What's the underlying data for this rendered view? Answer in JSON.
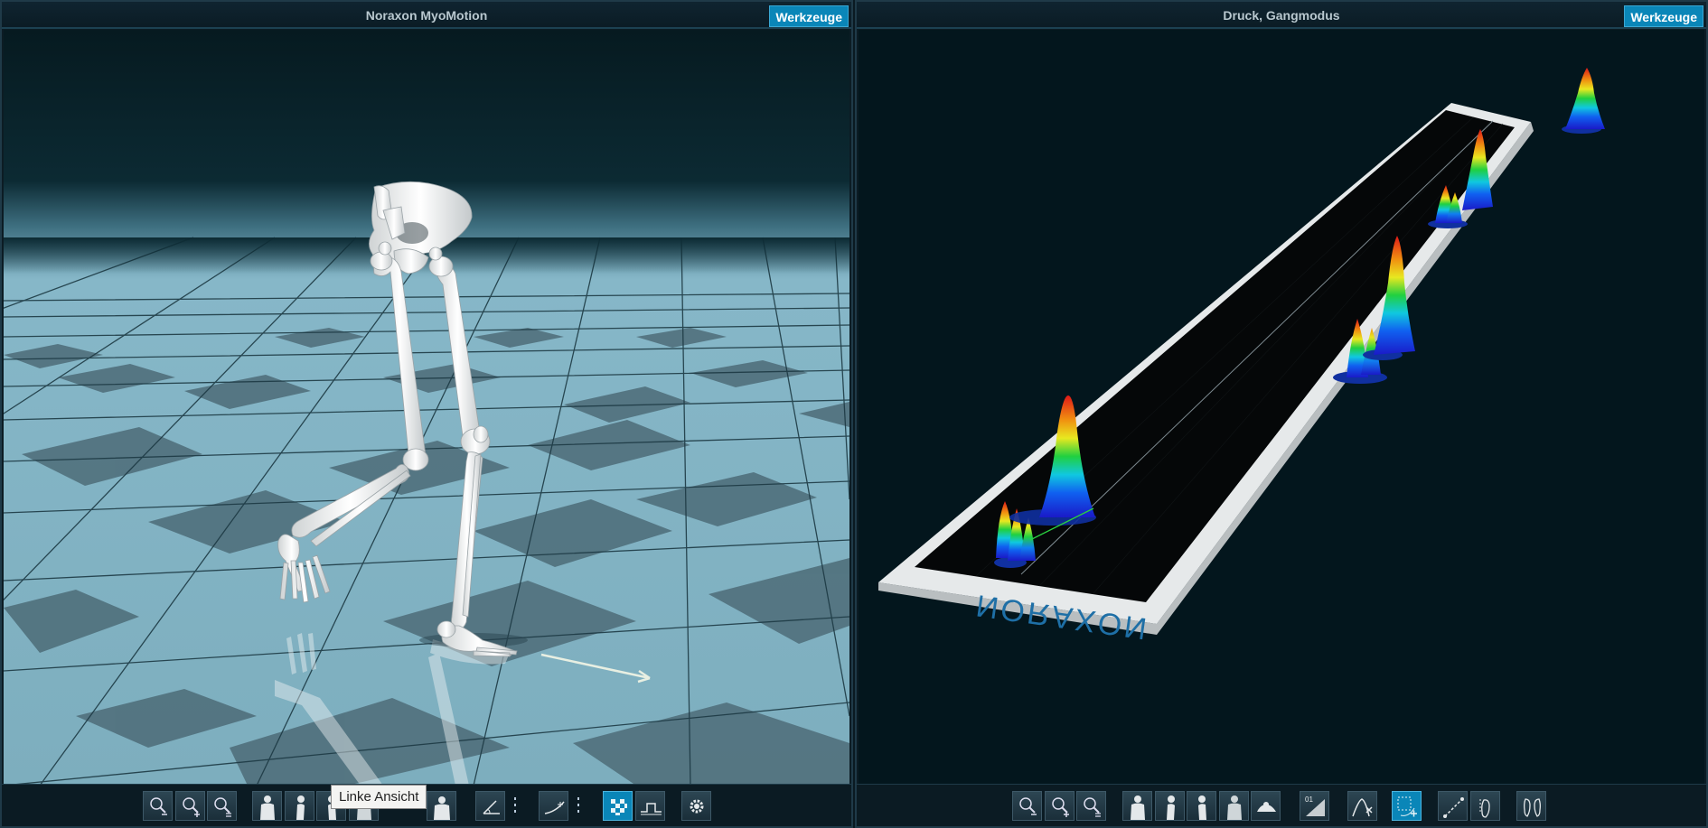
{
  "left_panel": {
    "title": "Noraxon MyoMotion",
    "tools_label": "Werkzeuge",
    "tooltip": "Linke Ansicht"
  },
  "right_panel": {
    "title": "Druck, Gangmodus",
    "tools_label": "Werkzeuge",
    "mat_brand": "NORAXON",
    "label_01": "01"
  },
  "left_toolbar": {
    "buttons": [
      {
        "name": "zoom-out-button",
        "icon": "zoom-out-icon"
      },
      {
        "name": "zoom-in-button",
        "icon": "zoom-in-icon"
      },
      {
        "name": "zoom-fit-button",
        "icon": "zoom-fit-icon"
      },
      {
        "name": "front-view-button",
        "icon": "body-front-icon"
      },
      {
        "name": "left-view-button",
        "icon": "body-side-icon"
      },
      {
        "name": "right-view-button",
        "icon": "body-side-icon"
      },
      {
        "name": "back-view-button",
        "icon": "body-back-icon"
      },
      {
        "name": "top-view-button",
        "icon": "body-top-icon"
      },
      {
        "name": "angle-tool-button",
        "icon": "angle-icon"
      },
      {
        "name": "trajectory-button",
        "icon": "trajectory-icon"
      },
      {
        "name": "floor-grid-button",
        "icon": "checker-icon",
        "active": true
      },
      {
        "name": "step-signal-button",
        "icon": "step-signal-icon"
      },
      {
        "name": "settings-button",
        "icon": "gear-icon"
      }
    ]
  },
  "right_toolbar": {
    "buttons": [
      {
        "name": "zoom-out-button",
        "icon": "zoom-out-icon"
      },
      {
        "name": "zoom-in-button",
        "icon": "zoom-in-icon"
      },
      {
        "name": "zoom-fit-button",
        "icon": "zoom-fit-icon"
      },
      {
        "name": "front-view-button",
        "icon": "body-front-icon"
      },
      {
        "name": "side-view-button",
        "icon": "body-side-icon"
      },
      {
        "name": "side-view-2-button",
        "icon": "body-side-icon"
      },
      {
        "name": "back-view-button",
        "icon": "body-back-icon"
      },
      {
        "name": "top-view-button",
        "icon": "body-top-icon"
      },
      {
        "name": "scale-01-button",
        "icon": "ramp-icon"
      },
      {
        "name": "peak-x-button",
        "icon": "peak-x-icon"
      },
      {
        "name": "cop-add-button",
        "icon": "cop-add-icon",
        "active": true
      },
      {
        "name": "gait-line-button",
        "icon": "gait-line-icon"
      },
      {
        "name": "foot-print-button",
        "icon": "foot-icon"
      },
      {
        "name": "feet-pair-button",
        "icon": "feet-pair-icon"
      }
    ]
  },
  "colors": {
    "accent": "#0a86b8",
    "floor": "#7fb3c5",
    "background": "#0c1c24",
    "mat": "#e6e9ea"
  }
}
